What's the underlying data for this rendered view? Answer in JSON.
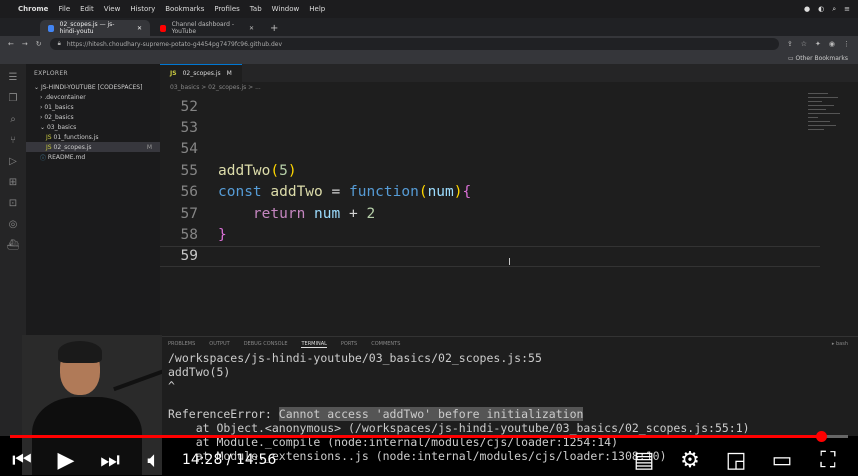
{
  "mac_menu": {
    "app": "Chrome",
    "items": [
      "File",
      "Edit",
      "View",
      "History",
      "Bookmarks",
      "Profiles",
      "Tab",
      "Window",
      "Help"
    ]
  },
  "browser": {
    "tabs": [
      {
        "title": "02_scopes.js — js-hindi-youtu"
      },
      {
        "title": "Channel dashboard - YouTube"
      }
    ],
    "url": "https://hitesh.choudhary-supreme-potato-g4454pg7479fc96.github.dev",
    "bookmarks_label": "Other Bookmarks"
  },
  "explorer": {
    "header": "EXPLORER",
    "root": "JS-HINDI-YOUTUBE [CODESPACES]",
    "items": [
      {
        "label": ".devcontainer",
        "indent": 1
      },
      {
        "label": "01_basics",
        "indent": 1
      },
      {
        "label": "02_basics",
        "indent": 1
      },
      {
        "label": "03_basics",
        "indent": 1
      },
      {
        "label": "01_functions.js",
        "indent": 2
      },
      {
        "label": "02_scopes.js",
        "indent": 2,
        "selected": true,
        "badge": "M"
      },
      {
        "label": "README.md",
        "indent": 1
      }
    ]
  },
  "editor": {
    "tab": "02_scopes.js",
    "tab_badge": "M",
    "breadcrumb": "03_basics > 02_scopes.js > ...",
    "line_numbers": [
      "52",
      "53",
      "54",
      "55",
      "56",
      "57",
      "58",
      "59"
    ]
  },
  "code": {
    "l55": {
      "fn": "addTwo",
      "open": "(",
      "num": "5",
      "close": ")"
    },
    "l56": {
      "kw": "const",
      "name": "addTwo",
      "eq": " = ",
      "fnkw": "function",
      "open": "(",
      "param": "num",
      "close": ")",
      "brace": "{"
    },
    "l57": {
      "ret": "return",
      "var": "num",
      "op": " + ",
      "num": "2"
    },
    "l58": {
      "brace": "}"
    }
  },
  "panel": {
    "tabs": [
      "PROBLEMS",
      "OUTPUT",
      "DEBUG CONSOLE",
      "TERMINAL",
      "PORTS",
      "COMMENTS"
    ],
    "active_tab": "TERMINAL",
    "shell": "bash",
    "lines": [
      "/workspaces/js-hindi-youtube/03_basics/02_scopes.js:55",
      "addTwo(5)",
      "^",
      "",
      "    at Object.<anonymous> (/workspaces/js-hindi-youtube/03_basics/02_scopes.js:55:1)",
      "    at Module._compile (node:internal/modules/cjs/loader:1254:14)",
      "    at Module._extensions..js (node:internal/modules/cjs/loader:1308:10)"
    ],
    "error_prefix": "ReferenceError: ",
    "error_msg": "Cannot access 'addTwo' before initialization"
  },
  "player": {
    "current_time": "14:28",
    "separator": " / ",
    "duration": "14:56",
    "progress": 0.968,
    "colors": {
      "progress": "#ff0000",
      "track": "#666666"
    },
    "icons": [
      "prev-icon",
      "play-icon",
      "next-icon",
      "volume-icon",
      "subtitles-icon",
      "settings-icon",
      "miniplayer-icon",
      "theater-icon",
      "fullscreen-icon"
    ]
  }
}
